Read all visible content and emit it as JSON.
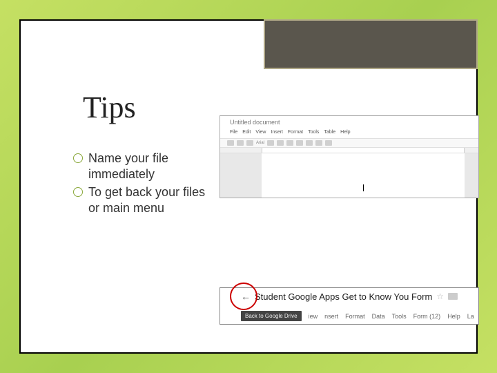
{
  "slide": {
    "title": "Tips",
    "bullets": [
      "Name your file immediately",
      "To get back your files or main menu"
    ]
  },
  "screenshot_docs": {
    "doc_title": "Untitled document",
    "menu": [
      "File",
      "Edit",
      "View",
      "Insert",
      "Format",
      "Tools",
      "Table",
      "Help"
    ],
    "toolbar": {
      "font_label": "Arial"
    }
  },
  "screenshot_drive": {
    "back_arrow_glyph": "←",
    "doc_title": "Student Google Apps Get to Know You Form",
    "star_glyph": "☆",
    "back_badge": "Back to Google Drive",
    "menu": [
      "iew",
      "nsert",
      "Format",
      "Data",
      "Tools",
      "Form (12)",
      "Help",
      "La"
    ]
  }
}
